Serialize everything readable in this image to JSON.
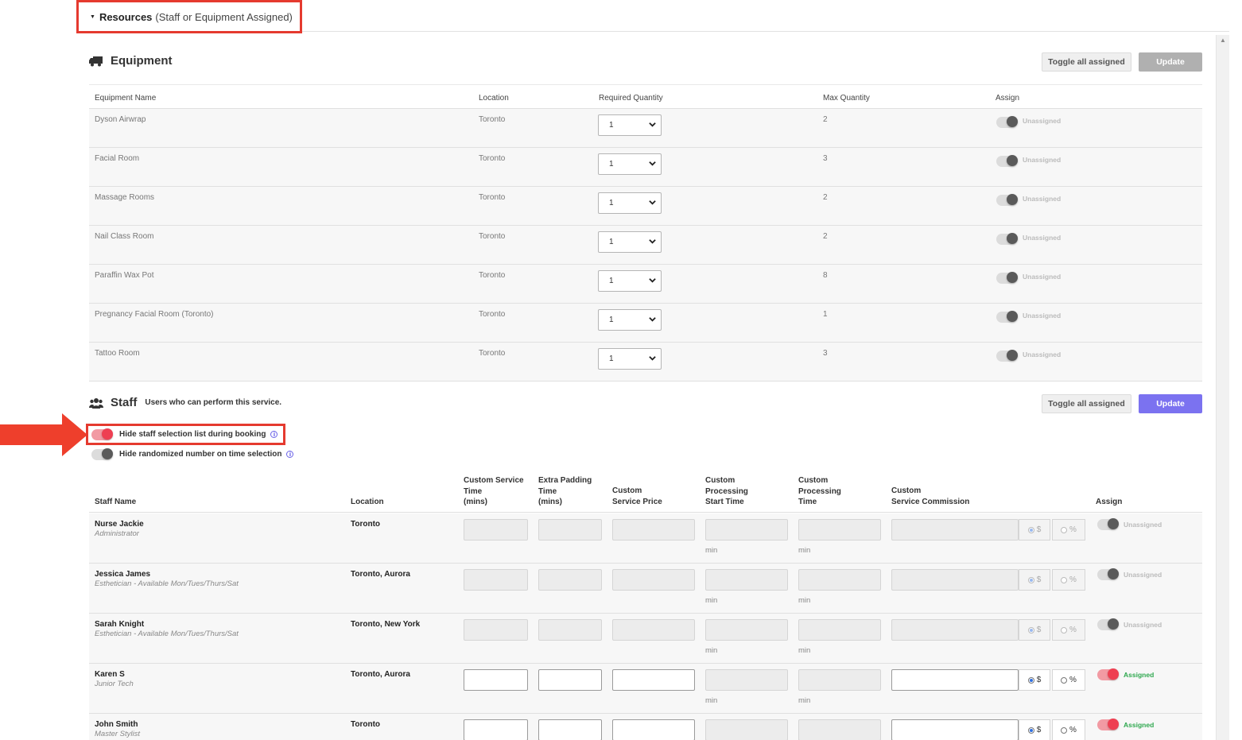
{
  "resources_header": {
    "title": "Resources",
    "subtitle": "(Staff or Equipment Assigned)"
  },
  "equipment": {
    "title": "Equipment",
    "toggle_all_label": "Toggle all assigned",
    "update_label": "Update",
    "columns": [
      "Equipment Name",
      "Location",
      "Required Quantity",
      "Max Quantity",
      "Assign"
    ],
    "rows": [
      {
        "name": "Dyson Airwrap",
        "location": "Toronto",
        "required": "1",
        "max": "2",
        "assign": "Unassigned"
      },
      {
        "name": "Facial Room",
        "location": "Toronto",
        "required": "1",
        "max": "3",
        "assign": "Unassigned"
      },
      {
        "name": "Massage Rooms",
        "location": "Toronto",
        "required": "1",
        "max": "2",
        "assign": "Unassigned"
      },
      {
        "name": "Nail Class Room",
        "location": "Toronto",
        "required": "1",
        "max": "2",
        "assign": "Unassigned"
      },
      {
        "name": "Paraffin Wax Pot",
        "location": "Toronto",
        "required": "1",
        "max": "8",
        "assign": "Unassigned"
      },
      {
        "name": "Pregnancy Facial Room (Toronto)",
        "location": "Toronto",
        "required": "1",
        "max": "1",
        "assign": "Unassigned"
      },
      {
        "name": "Tattoo Room",
        "location": "Toronto",
        "required": "1",
        "max": "3",
        "assign": "Unassigned"
      }
    ]
  },
  "staff": {
    "title": "Staff",
    "description": "Users who can perform this service.",
    "toggle_all_label": "Toggle all assigned",
    "update_label": "Update",
    "options": [
      {
        "label": "Hide staff selection list during booking",
        "enabled": true
      },
      {
        "label": "Hide randomized number on time selection",
        "enabled": false
      }
    ],
    "columns": {
      "staff_name": "Staff Name",
      "location": "Location",
      "custom_service_time": [
        "Custom Service",
        "Time",
        "(mins)"
      ],
      "extra_padding": [
        "Extra Padding",
        "Time",
        "(mins)"
      ],
      "custom_price": [
        "Custom",
        "Service Price"
      ],
      "processing_start": [
        "Custom",
        "Processing",
        "Start Time"
      ],
      "processing_time": [
        "Custom",
        "Processing",
        "Time"
      ],
      "commission": [
        "Custom",
        "Service Commission"
      ],
      "assign": "Assign"
    },
    "min_label": "min",
    "dollar_label": "$",
    "percent_label": "%",
    "rows": [
      {
        "name": "Nurse Jackie",
        "role": "Administrator",
        "location": "Toronto",
        "assign": "Unassigned",
        "assigned": false
      },
      {
        "name": "Jessica James",
        "role": "Esthetician - Available Mon/Tues/Thurs/Sat",
        "location": "Toronto, Aurora",
        "assign": "Unassigned",
        "assigned": false
      },
      {
        "name": "Sarah Knight",
        "role": "Esthetician - Available Mon/Tues/Thurs/Sat",
        "location": "Toronto, New York",
        "assign": "Unassigned",
        "assigned": false
      },
      {
        "name": "Karen S",
        "role": "Junior Tech",
        "location": "Toronto, Aurora",
        "assign": "Assigned",
        "assigned": true
      },
      {
        "name": "John Smith",
        "role": "Master Stylist",
        "location": "Toronto",
        "assign": "Assigned",
        "assigned": true
      }
    ]
  },
  "colors": {
    "highlight": "#e53a2f",
    "update_active": "#7b72f0",
    "toggle_on": "#ee3f52",
    "assigned_text": "#2fa84f"
  }
}
